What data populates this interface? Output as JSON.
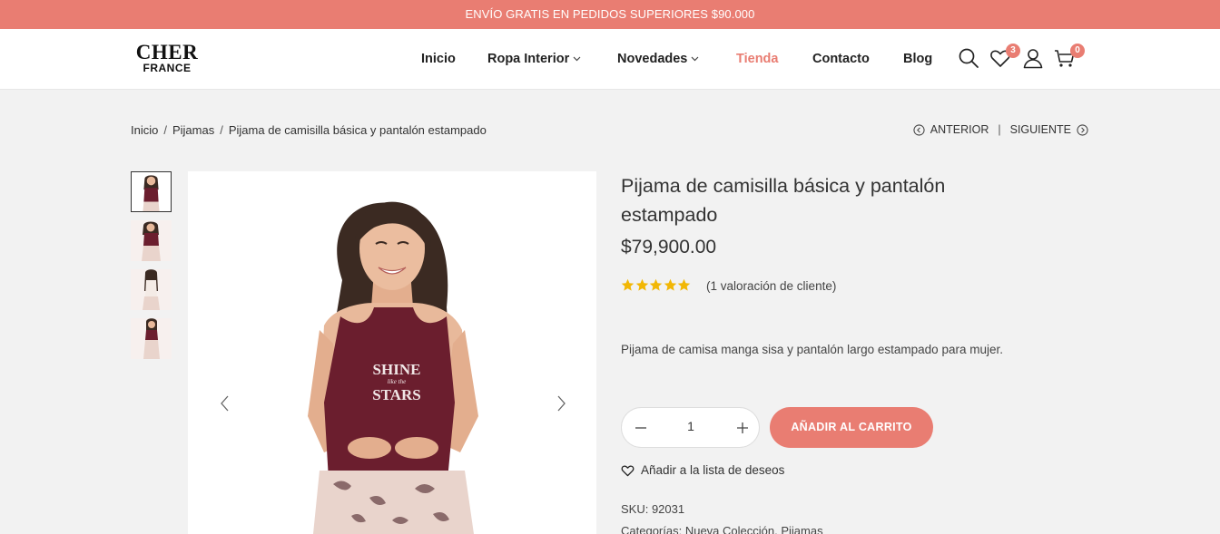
{
  "promo": {
    "text": "ENVÍO GRATIS EN PEDIDOS SUPERIORES $90.000"
  },
  "logo": {
    "main": "CHER",
    "sub": "FRANCE"
  },
  "nav": {
    "inicio": "Inicio",
    "ropa_interior": "Ropa Interior",
    "novedades": "Novedades",
    "tienda": "Tienda",
    "contacto": "Contacto",
    "blog": "Blog"
  },
  "header_icons": {
    "search": "search-icon",
    "wishlist": "heart-icon",
    "wishlist_count": "3",
    "account": "user-icon",
    "cart": "cart-icon",
    "cart_count": "0"
  },
  "breadcrumb": {
    "home": "Inicio",
    "category": "Pijamas",
    "current": "Pijama de camisilla básica y pantalón estampado",
    "separator": "/"
  },
  "pager": {
    "prev": "ANTERIOR",
    "separator": "|",
    "next": "SIGUIENTE"
  },
  "product": {
    "title": "Pijama de camisilla básica y pantalón estampado",
    "price": "$79,900.00",
    "rating": 5,
    "reviews": "(1 valoración de cliente)",
    "description": "Pijama de camisa manga sisa y pantalón largo estampado para mujer.",
    "quantity": "1",
    "add_to_cart": "AÑADIR AL CARRITO",
    "wishlist": "Añadir a la lista de deseos",
    "sku": "SKU: 92031",
    "categories_label": "Categorías:",
    "categories": [
      "Nueva Colección",
      "Pijamas"
    ],
    "shirt_print": [
      "SHINE",
      "like the",
      "STARS"
    ]
  },
  "colors": {
    "accent": "#e97d72",
    "top": "#6b1e2e",
    "skin": "#e8b99b",
    "hair": "#3b2a22",
    "pants": "#e9d4cc"
  }
}
